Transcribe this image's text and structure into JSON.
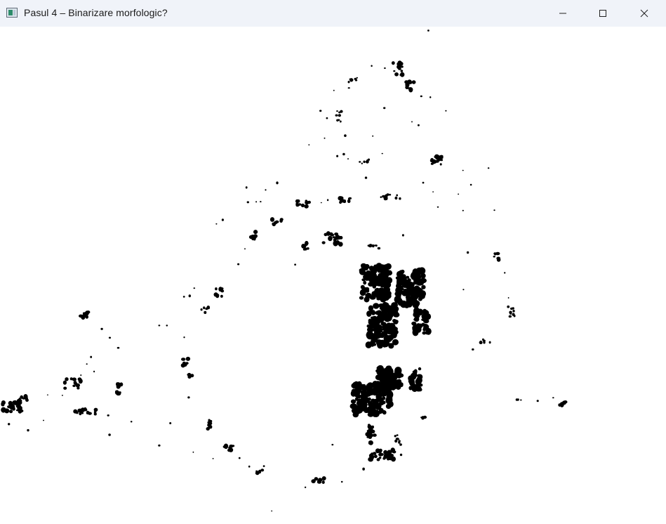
{
  "window": {
    "title": "Pasul 4 – Binarizare morfologic?",
    "icon": "app-window-icon",
    "controls": {
      "minimize": "minimize-icon",
      "maximize": "maximize-icon",
      "close": "close-icon"
    }
  },
  "canvas": {
    "background": "#ffffff",
    "foreground": "#000000"
  },
  "colors": {
    "titlebar_bg": "#f0f3f9",
    "title_text": "#1a1a1a",
    "glyph": "#202020"
  }
}
